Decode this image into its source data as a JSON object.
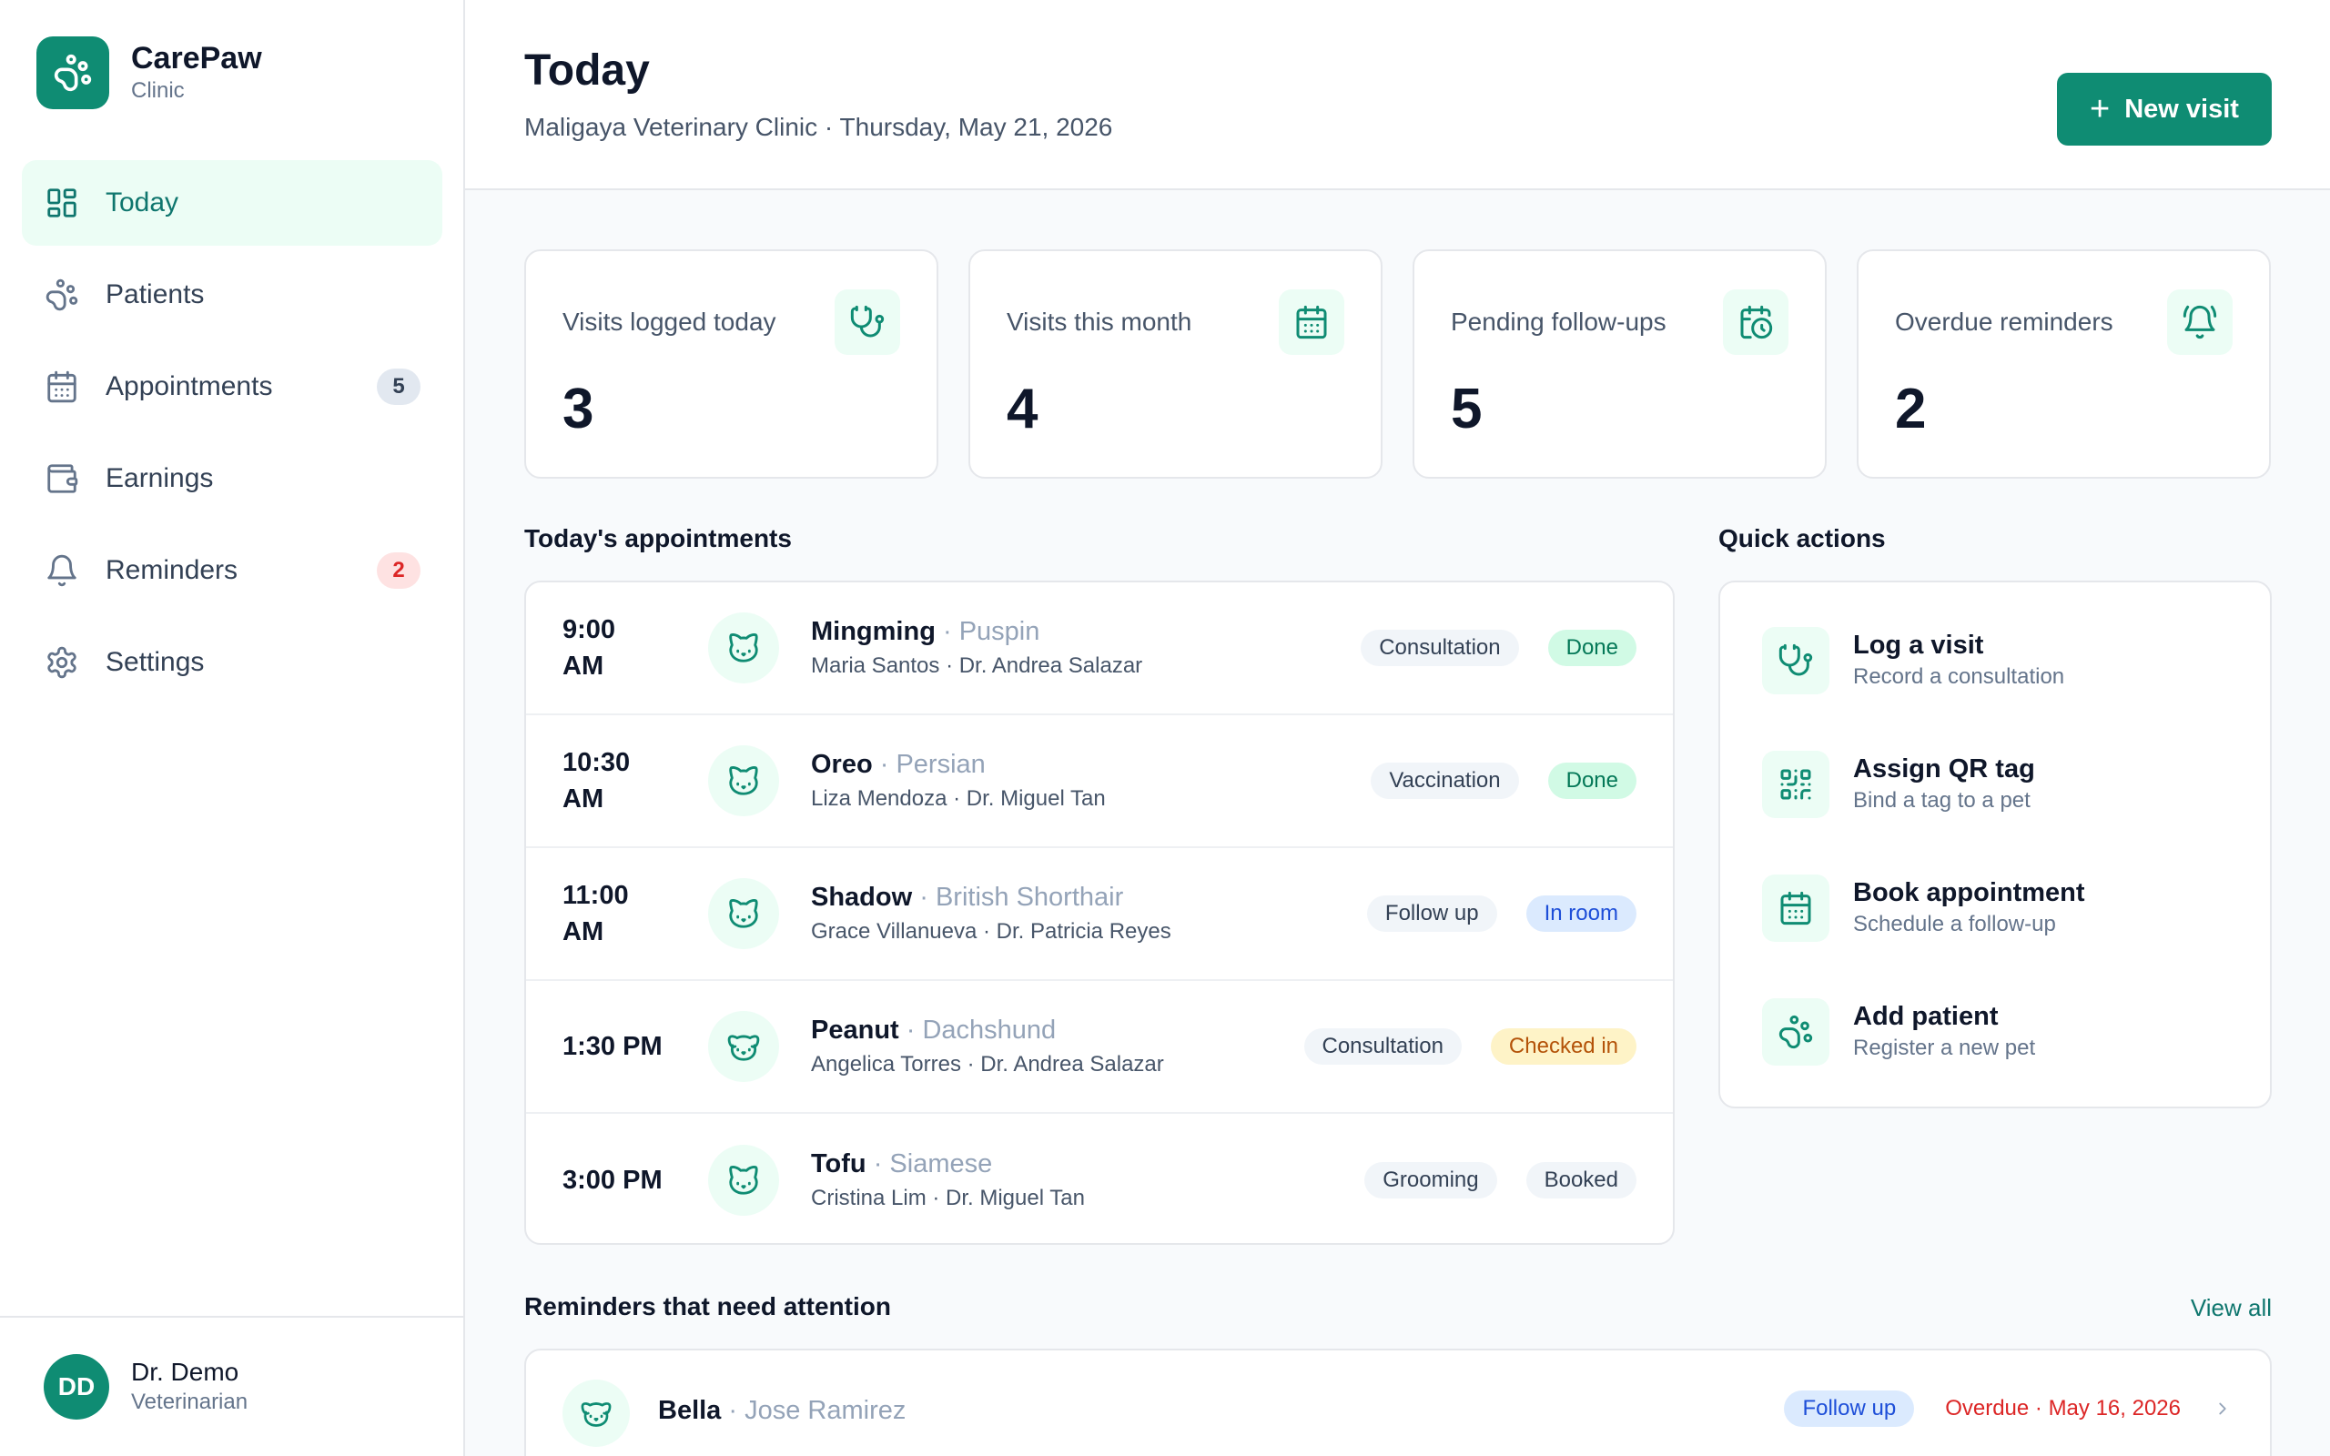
{
  "brand": {
    "name": "CarePaw",
    "sub": "Clinic"
  },
  "nav": [
    {
      "label": "Today",
      "icon": "grid-icon",
      "active": true,
      "badge": ""
    },
    {
      "label": "Patients",
      "icon": "paw-icon",
      "badge": ""
    },
    {
      "label": "Appointments",
      "icon": "calendar-icon",
      "badge": "5"
    },
    {
      "label": "Earnings",
      "icon": "wallet-icon",
      "badge": ""
    },
    {
      "label": "Reminders",
      "icon": "bell-icon",
      "badge": "2"
    },
    {
      "label": "Settings",
      "icon": "gear-icon",
      "badge": ""
    }
  ],
  "user": {
    "initials": "DD",
    "name": "Dr. Demo",
    "role": "Veterinarian"
  },
  "header": {
    "title": "Today",
    "subtitle": "Maligaya Veterinary Clinic · Thursday, May 21, 2026",
    "new_visit_label": "New visit"
  },
  "stats": [
    {
      "label": "Visits logged today",
      "value": "3",
      "icon": "stethoscope-icon"
    },
    {
      "label": "Visits this month",
      "value": "4",
      "icon": "calendar-icon"
    },
    {
      "label": "Pending follow-ups",
      "value": "5",
      "icon": "calendar-clock-icon"
    },
    {
      "label": "Overdue reminders",
      "value": "2",
      "icon": "alarm-bell-icon"
    }
  ],
  "appointments": {
    "title": "Today's appointments",
    "items": [
      {
        "time": "9:00 AM",
        "pet": "Mingming",
        "breed": "· Puspin",
        "owner": "Maria Santos · Dr. Andrea Salazar",
        "type": "Consultation",
        "status": "Done"
      },
      {
        "time": "10:30 AM",
        "pet": "Oreo",
        "breed": "· Persian",
        "owner": "Liza Mendoza · Dr. Miguel Tan",
        "type": "Vaccination",
        "status": "Done"
      },
      {
        "time": "11:00 AM",
        "pet": "Shadow",
        "breed": "· British Shorthair",
        "owner": "Grace Villanueva · Dr. Patricia Reyes",
        "type": "Follow up",
        "status": "In room"
      },
      {
        "time": "1:30 PM",
        "pet": "Peanut",
        "breed": "· Dachshund",
        "owner": "Angelica Torres · Dr. Andrea Salazar",
        "type": "Consultation",
        "status": "Checked in"
      },
      {
        "time": "3:00 PM",
        "pet": "Tofu",
        "breed": "· Siamese",
        "owner": "Cristina Lim · Dr. Miguel Tan",
        "type": "Grooming",
        "status": "Booked"
      }
    ]
  },
  "quick_actions": {
    "title": "Quick actions",
    "items": [
      {
        "title": "Log a visit",
        "sub": "Record a consultation",
        "icon": "stethoscope-icon"
      },
      {
        "title": "Assign QR tag",
        "sub": "Bind a tag to a pet",
        "icon": "qr-code-icon"
      },
      {
        "title": "Book appointment",
        "sub": "Schedule a follow-up",
        "icon": "calendar-icon"
      },
      {
        "title": "Add patient",
        "sub": "Register a new pet",
        "icon": "paw-icon"
      }
    ]
  },
  "reminders": {
    "title": "Reminders that need attention",
    "view_all": "View all",
    "items": [
      {
        "pet": "Bella",
        "owner": "· Jose Ramirez",
        "type": "Follow up",
        "due": "Overdue · May 16, 2026"
      }
    ]
  },
  "colors": {
    "accent": "#0f8c73",
    "accent_soft": "#ecfdf5",
    "danger": "#dc2626"
  }
}
